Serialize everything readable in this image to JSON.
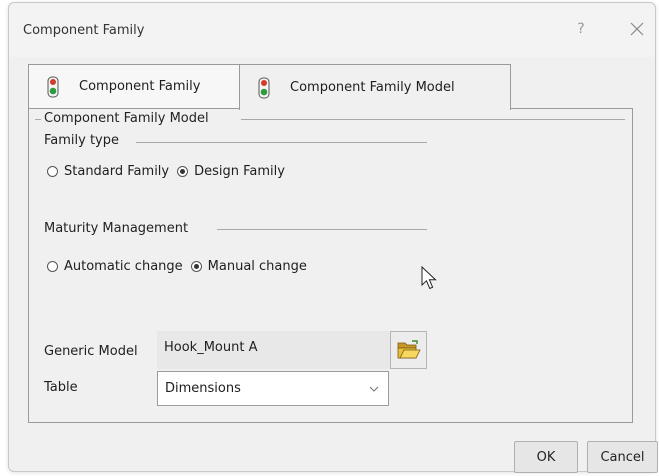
{
  "window": {
    "title": "Component Family",
    "help_label": "?"
  },
  "tabs": [
    {
      "label": "Component Family",
      "icon": "traffic-light-icon",
      "active": false
    },
    {
      "label": "Component Family Model",
      "icon": "traffic-light-icon",
      "active": true
    }
  ],
  "panel": {
    "group_title": "Component Family Model",
    "family_type": {
      "title": "Family type",
      "options": [
        {
          "label": "Standard Family",
          "selected": false
        },
        {
          "label": "Design Family",
          "selected": true
        }
      ]
    },
    "maturity": {
      "title": "Maturity Management",
      "options": [
        {
          "label": "Automatic change",
          "selected": false
        },
        {
          "label": "Manual change",
          "selected": true
        }
      ]
    },
    "generic_model": {
      "label": "Generic Model",
      "value": "Hook_Mount A",
      "browse_icon": "folder-open-icon"
    },
    "table": {
      "label": "Table",
      "value": "Dimensions"
    }
  },
  "buttons": {
    "ok": "OK",
    "cancel": "Cancel"
  },
  "colors": {
    "dialog_bg": "#f0f0f0",
    "icon_green": "#2e9b3e",
    "icon_red": "#d23a2a",
    "folder_yellow": "#e8c03a"
  }
}
